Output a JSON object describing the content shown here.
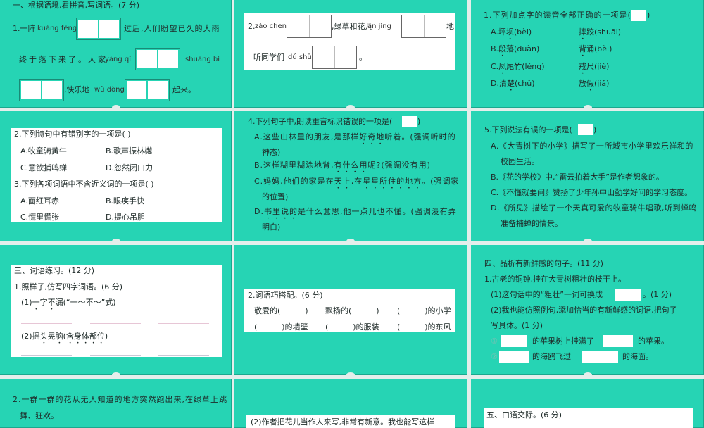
{
  "colors": {
    "panel": "#26d4b4",
    "gap": "#e4eeeb",
    "white": "#ffffff"
  },
  "p1": {
    "heading": "一、根据语境,看拼音,写词语。(7 分)",
    "l1a": "1.一阵",
    "py1": "kuáng fēng",
    "l1b": "过后,人们盼望已久的大雨",
    "l2a": "终于落下来了。大家",
    "py2": "yáng qǐ",
    "py3": "shuāng bì",
    "l3a": ",快乐地",
    "py4": "wǔ dòng",
    "l3b": "起来。"
  },
  "p2": {
    "num": "2.",
    "py1": "zǎo chen",
    "a": ",绿草和花儿",
    "py2": "ān jìng",
    "b": "地",
    "c": "听同学们",
    "py3": "dú shū",
    "d": "。"
  },
  "p3": {
    "q": "1.下列加点字的读音全部正确的一项是(",
    "q_end": ")",
    "options": [
      {
        "l": [
          "A.坪",
          "坝",
          "(bèi)"
        ],
        "r": [
          "摔",
          "跤",
          "(shuāi)"
        ]
      },
      {
        "l": [
          "B.",
          "段",
          "落(duàn)"
        ],
        "r": [
          "背",
          "诵",
          "(bèi)"
        ]
      },
      {
        "l": [
          "C.",
          "凤",
          "尾竹(lěng)"
        ],
        "r": [
          "",
          "戒",
          "尺(jiè)"
        ]
      },
      {
        "l": [
          "D.清",
          "楚",
          "(chǔ)"
        ],
        "r": [
          "放",
          "假",
          "(jiǎ)"
        ]
      }
    ]
  },
  "p4": {
    "q2": "2.下列诗句中有错别字的一项是(      )",
    "q2_opts": [
      "A.牧童骑黄牛",
      "B.歌声振林樾",
      "C.意欲捕鸣蝉",
      "D.忽然闭口力"
    ],
    "q3": "3.下列各项词语中不含近义词的一项是(      )",
    "q3_opts": [
      "A.面红耳赤",
      "B.眼疾手快",
      "C.慌里慌张",
      "D.提心吊胆"
    ]
  },
  "p5": {
    "q": "4.下列句子中,朗读重音标识错误的一项是(",
    "q_end": ")",
    "a1": "A.这些山林里的朋友,是那样",
    "a1d": "好奇地",
    "a1e": "听着。(强调听时的",
    "a2": "神态)",
    "b1": "B.这样糊里糊涂地背,",
    "b1d": "有什么用",
    "b1e": "呢?(强调没有用)",
    "c1": "C.妈妈,他们的家是在",
    "c1d": "天上",
    "c1m": ",在",
    "c1d2": "星星所住的地方",
    "c1e": "。(强调家",
    "c2": "的位置)",
    "d1": "D.",
    "d1d": "书里说的",
    "d1e": "是什么意思,他一点儿也不懂。(强调没有弄",
    "d2": "明白)"
  },
  "p6": {
    "q": "5.下列说法有误的一项是(",
    "q_end": ")",
    "lines": [
      "A.《大青树下的小学》描写了一所城市小学里欢乐祥和的",
      "校园生活。",
      "B.《花的学校》中,“雷云拍着大手”是作者想象的。",
      "C.《不懂就要问》赞扬了少年孙中山勤学好问的学习态度。",
      "D.《所见》描绘了一个天真可爱的牧童骑牛唱歌,听到蝉鸣",
      "准备捕蝉的情景。"
    ]
  },
  "p7": {
    "h": "三、词语练习。(12 分)",
    "q1": "1.照样子,仿写四字词语。(6 分)",
    "s1a": "(1)",
    "s1b": "一",
    "s1c": "字",
    "s1d": "不",
    "s1e": "漏(“一～不～”式)",
    "s2a": "(2)摇",
    "s2b": "头",
    "s2c": "晃",
    "s2d": "脑(含身体部位)"
  },
  "p8": {
    "q": "2.词语巧搭配。(6 分)",
    "row1": [
      "敬爱的(          )",
      "飘扬的(          )",
      "(          )的小学"
    ],
    "row2": [
      "(          )的墙壁",
      "(          )的服装",
      "(          )的东风"
    ]
  },
  "p9": {
    "h": "四、品析有新鲜感的句子。(11 分)",
    "q1": "1.古老的铜钟,挂在大青树粗壮的枝干上。",
    "s1a": "(1)这句话中的“粗壮”一词可换成",
    "s1b": "。(1 分)",
    "s2": "(2)我也能仿照例句,添加恰当的有新鲜感的词语,把句子",
    "s2b": "写具体。(1 分)",
    "e1a": "①",
    "e1b": "的苹果树上挂满了",
    "e1c": "的苹果。",
    "e2a": "②",
    "e2b": "的海鸥飞过",
    "e2c": "的海面。"
  },
  "p10": {
    "l1": "2.一群一群的花从无人知道的地方突然跑出来,在绿草上跳",
    "l2": "舞、狂欢。"
  },
  "p11": {
    "l1": "(2)作者把花儿当作人来写,非常有新意。我也能写这样"
  },
  "p12": {
    "h": "五、口语交际。(6 分)"
  }
}
